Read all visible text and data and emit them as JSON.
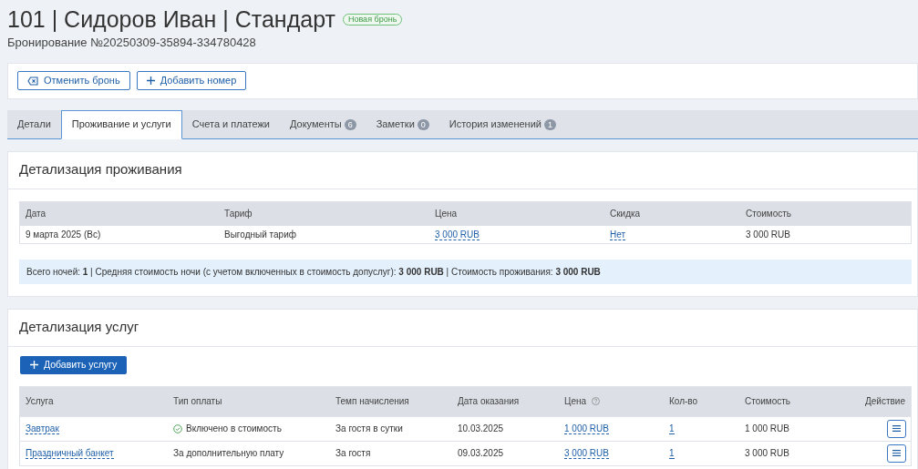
{
  "header": {
    "title": "101 | Сидоров Иван | Стандарт",
    "badge": "Новая бронь",
    "subtitle": "Бронирование №20250309-35894-334780428"
  },
  "actions": [
    {
      "kind": "cancel",
      "label": "Отменить бронь"
    },
    {
      "kind": "add",
      "label": "Добавить номер"
    }
  ],
  "tabs": [
    {
      "label": "Детали",
      "selected": false
    },
    {
      "label": "Проживание и услуги",
      "selected": true
    },
    {
      "label": "Счета и платежи",
      "selected": false
    },
    {
      "label": "Документы",
      "count": "6",
      "selected": false
    },
    {
      "label": "Заметки",
      "count": "0",
      "selected": false
    },
    {
      "label": "История изменений",
      "count": "1",
      "selected": false
    }
  ],
  "stay": {
    "title": "Детализация проживания",
    "columns": [
      "Дата",
      "Тариф",
      "Цена",
      "Скидка",
      "Стоимость"
    ],
    "rows": [
      {
        "date": "9 марта 2025 (Вс)",
        "tariff": "Выгодный тариф",
        "price": "3 000 RUB",
        "discount": "Нет",
        "cost": "3 000 RUB"
      }
    ],
    "summary": "Всего ночей: **1** | Средняя стоимость ночи (с учетом включенных в стоимость допуслуг): **3 000 RUB** | Стоимость проживания: **3 000 RUB**"
  },
  "services": {
    "title": "Детализация услуг",
    "add_button": "Добавить услугу",
    "columns": [
      {
        "label": "Услуга"
      },
      {
        "label": "Тип оплаты"
      },
      {
        "label": "Темп начисления"
      },
      {
        "label": "Дата оказания"
      },
      {
        "label": "Цена",
        "help": true
      },
      {
        "label": "Кол-во"
      },
      {
        "label": "Стоимость"
      },
      {
        "label": "Действие"
      }
    ],
    "rows": [
      {
        "service": "Завтрак",
        "payment": "Включено в стоимость",
        "included": true,
        "rate": "За гостя в сутки",
        "date": "10.03.2025",
        "price": "1 000 RUB",
        "qty": "1",
        "cost": "1 000 RUB"
      },
      {
        "service": "Праздничный банкет",
        "payment": "За дополнительную плату",
        "included": false,
        "rate": "За гостя",
        "date": "09.03.2025",
        "price": "3 000 RUB",
        "qty": "1",
        "cost": "3 000 RUB"
      }
    ]
  }
}
